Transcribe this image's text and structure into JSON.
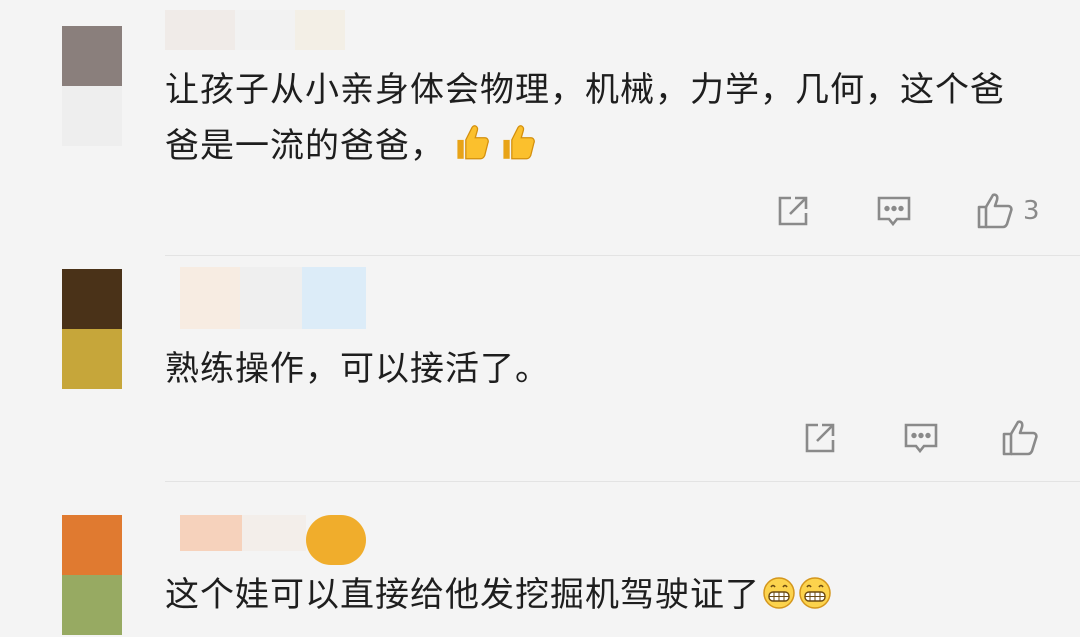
{
  "comments": [
    {
      "text": "让孩子从小亲身体会物理，机械，力学，几何，这个爸爸是一流的爸爸，",
      "emoji": [
        "thumbs-up-emoji",
        "thumbs-up-emoji"
      ],
      "like_count": "3",
      "avatar_colors": [
        "#8a7f7c",
        "#eeeeee"
      ]
    },
    {
      "text": "熟练操作，可以接活了。",
      "emoji": [],
      "like_count": "",
      "avatar_colors": [
        "#4a3218",
        "#c6a63a"
      ]
    },
    {
      "text": "这个娃可以直接给他发挖掘机驾驶证了",
      "emoji": [
        "grinning-face-emoji",
        "grinning-face-emoji"
      ],
      "like_count": "",
      "avatar_colors": [
        "#e07a30",
        "#97aa62"
      ]
    }
  ],
  "colors": {
    "background": "#f4f4f4",
    "text": "#1e1e1e",
    "icon": "#8a8a8a",
    "divider": "#e3e3e3"
  },
  "icons": [
    "share-icon",
    "reply-icon",
    "like-icon"
  ]
}
